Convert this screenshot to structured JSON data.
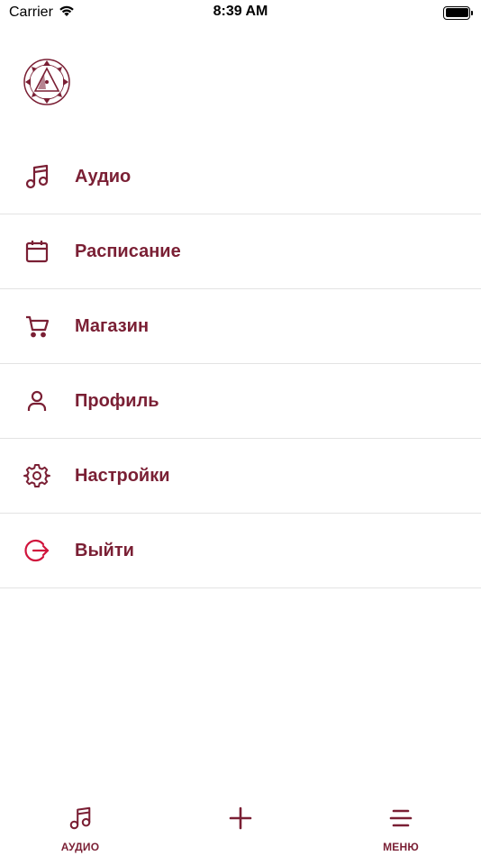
{
  "status_bar": {
    "carrier": "Carrier",
    "time": "8:39 AM",
    "battery_level": 1.0
  },
  "colors": {
    "accent": "#7a1f34",
    "logout": "#d0143c",
    "divider": "#e3e3e3"
  },
  "menu": {
    "items": [
      {
        "label": "Аудио",
        "icon": "music-note-icon"
      },
      {
        "label": "Расписание",
        "icon": "calendar-icon"
      },
      {
        "label": "Магазин",
        "icon": "cart-icon"
      },
      {
        "label": "Профиль",
        "icon": "user-icon"
      },
      {
        "label": "Настройки",
        "icon": "gear-icon"
      },
      {
        "label": "Выйти",
        "icon": "logout-icon"
      }
    ]
  },
  "tab_bar": {
    "tabs": [
      {
        "label": "АУДИО",
        "icon": "music-note-icon"
      },
      {
        "label": "",
        "icon": "plus-icon"
      },
      {
        "label": "МЕНЮ",
        "icon": "menu-icon"
      }
    ]
  }
}
